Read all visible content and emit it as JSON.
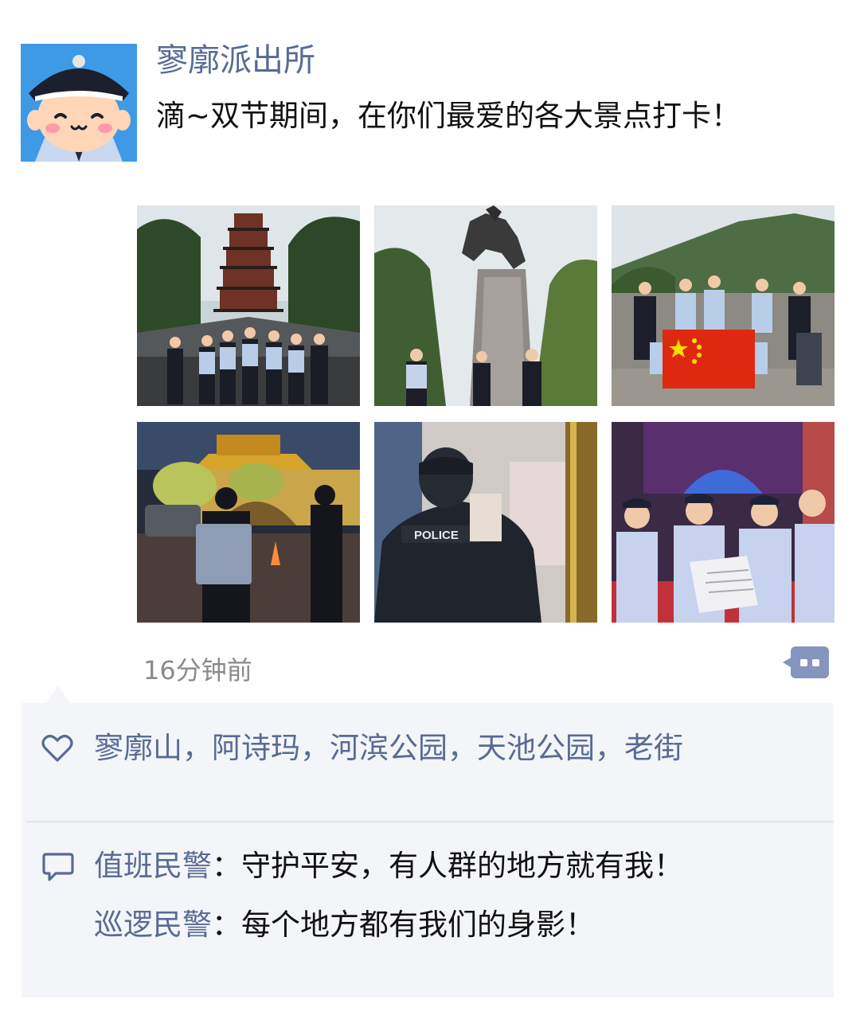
{
  "post": {
    "author": "寥廓派出所",
    "text": "滴~双节期间，在你们最爱的各大景点打卡！",
    "time": "16分钟前",
    "photos": [
      {
        "name": "photo-pagoda-police-lineup",
        "icon": "pagoda"
      },
      {
        "name": "photo-horse-statue-patrol",
        "icon": "statue"
      },
      {
        "name": "photo-flag-salute",
        "icon": "flag"
      },
      {
        "name": "photo-night-patrol-gate",
        "icon": "night-patrol"
      },
      {
        "name": "photo-police-back-interior",
        "icon": "police-back"
      },
      {
        "name": "photo-officers-reading-document",
        "icon": "officers-document"
      }
    ],
    "photo_badge_text": "POLICE"
  },
  "likes": {
    "icon": "heart-icon",
    "text": "寥廓山，阿诗玛，河滨公园，天池公园，老街"
  },
  "comments": [
    {
      "author": "值班民警",
      "separator": "：",
      "text": "守护平安，有人群的地方就有我！"
    },
    {
      "author": "巡逻民警",
      "separator": "：",
      "text": "每个地方都有我们的身影！"
    }
  ],
  "colors": {
    "link": "#576b95",
    "panel_bg": "#f4f5f8",
    "more_button": "#8695bd",
    "avatar_bg": "#3f9ae6"
  }
}
